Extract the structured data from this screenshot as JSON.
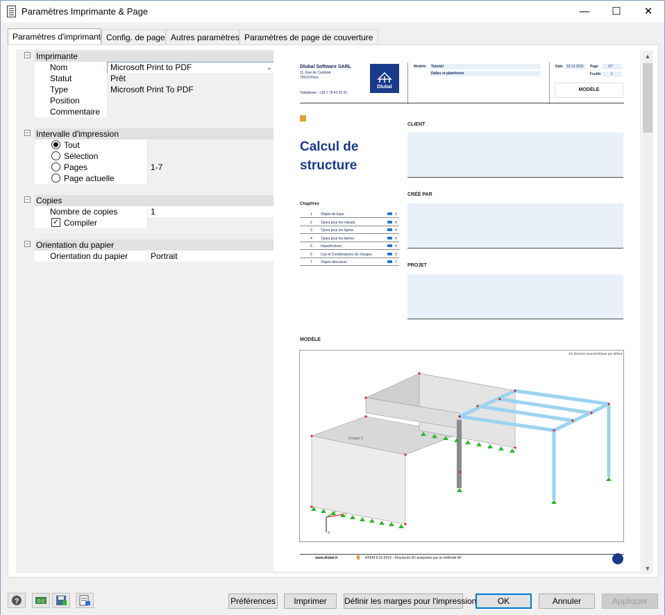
{
  "window": {
    "title": "Paramètres Imprimante & Page"
  },
  "tabs": [
    "Paramètres d'imprimante",
    "Config. de page",
    "Autres paramètres",
    "Paramètres de page de couverture"
  ],
  "sections": {
    "printer": {
      "title": "Imprimante",
      "name_label": "Nom",
      "name_value": "Microsoft Print to PDF",
      "status_label": "Statut",
      "status_value": "Prêt",
      "type_label": "Type",
      "type_value": "Microsoft Print To PDF",
      "position_label": "Position",
      "comment_label": "Commentaire"
    },
    "range": {
      "title": "Intervalle d'impression",
      "all": "Tout",
      "selection": "Sélection",
      "pages": "Pages",
      "pages_value": "1-7",
      "current": "Page actuelle"
    },
    "copies": {
      "title": "Copies",
      "count_label": "Nombre de copies",
      "count_value": "1",
      "collate_label": "Compiler"
    },
    "orientation": {
      "title": "Orientation du papier",
      "label": "Orientation du papier",
      "value": "Portrait"
    }
  },
  "preview": {
    "company": "Dlubal Software SARL",
    "address1": "11, Rue de Cambrai",
    "address2": "75019 Paris",
    "phone": "Téléphone : +33 1 78 42 91 61",
    "logo_text": "Dlubal",
    "model_label": "Modèle:",
    "model_value": "Tutoriel",
    "model_sub": "Dalles et plateforme",
    "date_label": "Date",
    "date_value": "10.12.2021",
    "page_label": "Page",
    "page_value": "1/7",
    "sheet_label": "Feuille",
    "sheet_value": "1",
    "model_box": "MODÈLE",
    "title_line1": "Calcul de",
    "title_line2": "structure",
    "client": "CLIENT",
    "created_by": "CRÉÉ PAR",
    "project": "PROJET",
    "chapters_title": "Chapitres",
    "chapters": [
      {
        "n": "1",
        "t": "Objets de base",
        "p": "3"
      },
      {
        "n": "2",
        "t": "Types pour les nœuds",
        "p": "4"
      },
      {
        "n": "3",
        "t": "Types pour les lignes",
        "p": "4"
      },
      {
        "n": "4",
        "t": "Types pour les barres",
        "p": "4"
      },
      {
        "n": "5",
        "t": "Imperfections",
        "p": "4"
      },
      {
        "n": "6",
        "t": "Cas et Combinaisons de charges",
        "p": "5"
      },
      {
        "n": "7",
        "t": "Objets directeurs",
        "p": "7"
      }
    ],
    "model_section": "MODÈLE",
    "view_note": "En direction axonométrique par défaut",
    "section_label": "Coupe 1",
    "footer_url": "www.dlubal.fr",
    "footer_text": "RFEM 6.02.0014 - Structures 3D analysées par la méthode EF"
  },
  "buttons": {
    "preferences": "Préférences",
    "print": "Imprimer",
    "margins": "Définir les marges pour l'impression",
    "ok": "OK",
    "cancel": "Annuler",
    "apply": "Appliquer"
  },
  "colors": {
    "accent": "#0078d7",
    "brand": "#1a3a8a",
    "member": "#9cd3f2",
    "support": "#2db82d",
    "node": "#e02020"
  }
}
